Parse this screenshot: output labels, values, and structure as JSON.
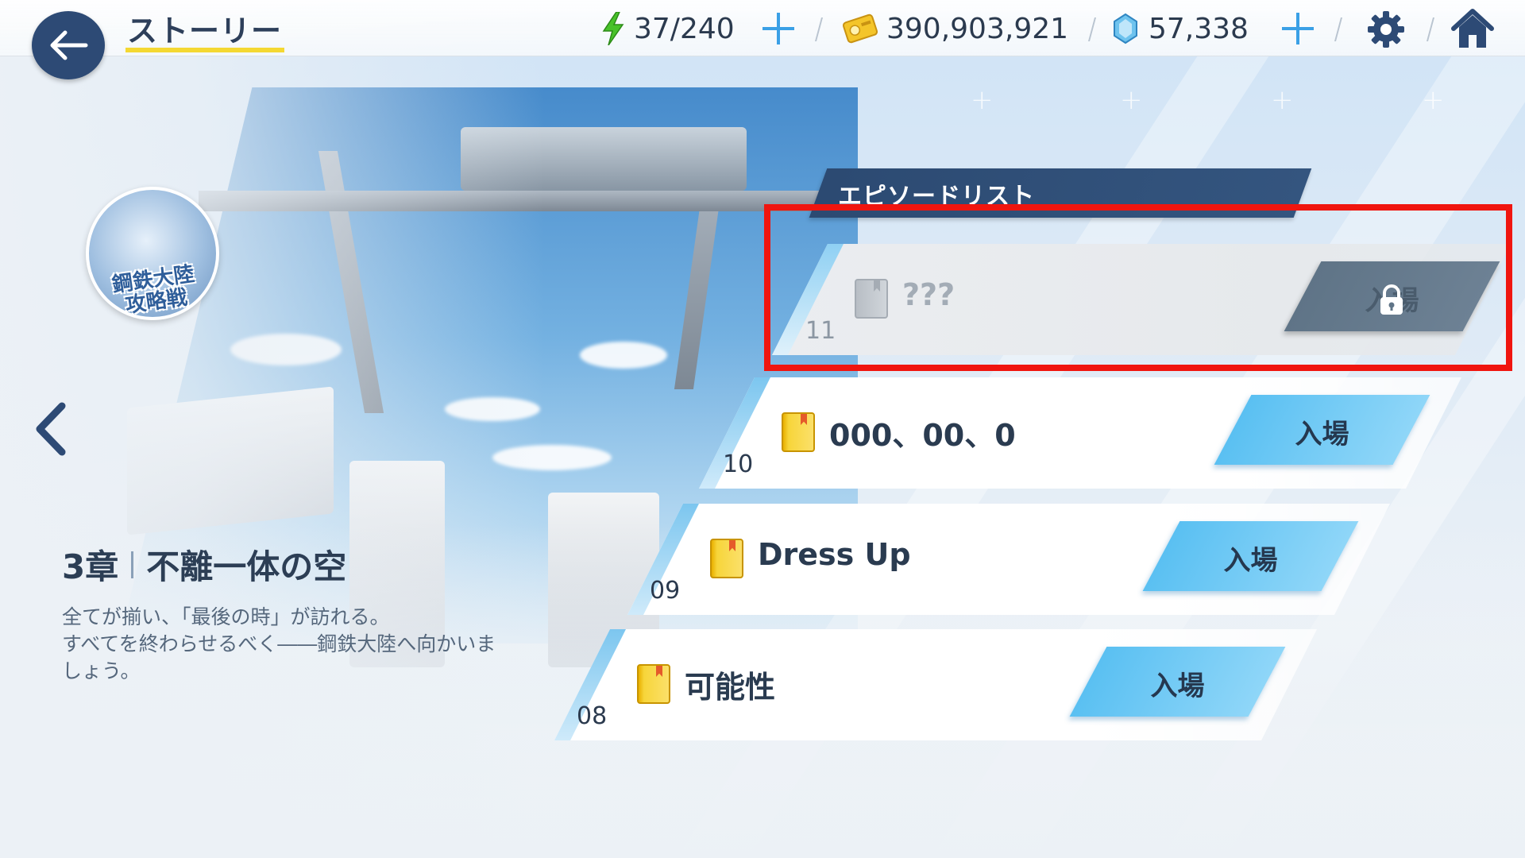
{
  "header": {
    "title": "ストーリー",
    "back_icon": "back-arrow-icon"
  },
  "resources": {
    "stamina": {
      "value": "37/240",
      "icon": "lightning-icon"
    },
    "credits": {
      "value": "390,903,921",
      "icon": "credit-card-icon"
    },
    "gems": {
      "value": "57,338",
      "icon": "gem-icon"
    }
  },
  "nav_icons": [
    "gear-icon",
    "home-icon"
  ],
  "event": {
    "badge_text": "鋼鉄大陸\n攻略戦"
  },
  "chapter": {
    "number": "3章",
    "title": "不離一体の空",
    "description": "全てが揃い、「最後の時」が訪れる。\nすべてを終わらせるべく――鋼鉄大陸へ向かいま\nしょう。"
  },
  "episode_list": {
    "header": "エピソードリスト",
    "episodes": [
      {
        "number": "11",
        "title": "???",
        "button": "入場",
        "locked": true
      },
      {
        "number": "10",
        "title": "000、00、0",
        "button": "入場",
        "locked": false
      },
      {
        "number": "09",
        "title": "Dress Up",
        "button": "入場",
        "locked": false
      },
      {
        "number": "08",
        "title": "可能性",
        "button": "入場",
        "locked": false
      }
    ]
  },
  "colors": {
    "accent_blue": "#5ac0f2",
    "header_navy": "#2c4a72",
    "title_underline": "#f4d832",
    "highlight_red": "#f0150f"
  }
}
